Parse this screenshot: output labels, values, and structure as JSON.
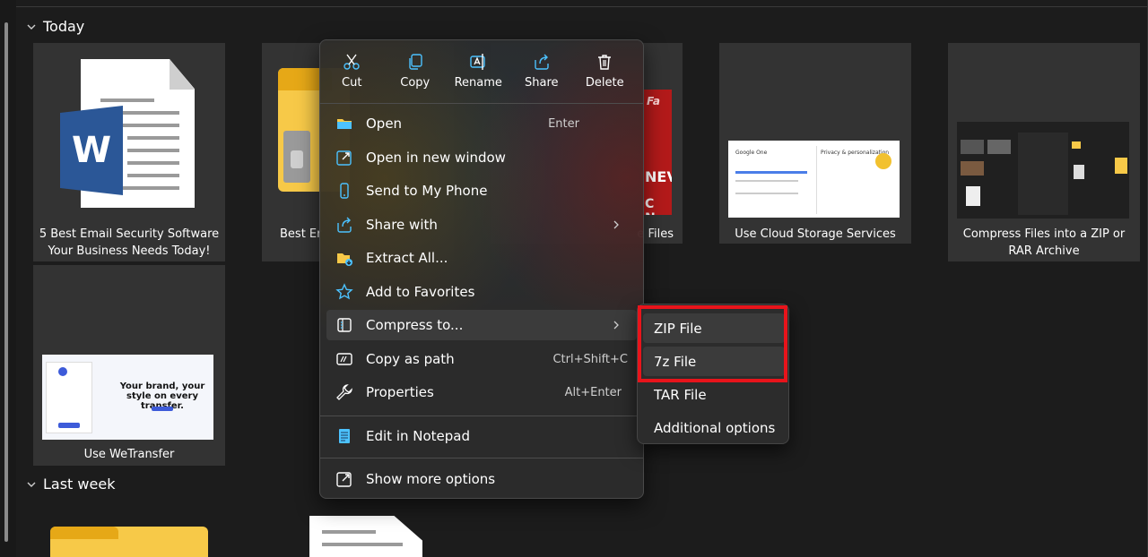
{
  "groups": {
    "today": "Today",
    "last_week": "Last week"
  },
  "tiles": [
    {
      "caption": "5 Best Email Security Software Your Business Needs Today!",
      "icon": "word-doc-icon"
    },
    {
      "caption": "Best Er",
      "icon": "zip-folder-icon"
    },
    {
      "caption": "e Files",
      "icon": "news-image"
    },
    {
      "caption": "Use Cloud Storage Services",
      "icon": "google-one-screenshot"
    },
    {
      "caption": "Compress Files into a ZIP or RAR Archive",
      "icon": "explorer-screenshot"
    },
    {
      "caption": "Use WeTransfer",
      "icon": "wetransfer-screenshot"
    }
  ],
  "thumb_text": {
    "google_one": "Google One",
    "privacy": "Privacy & personalization",
    "wetransfer_headline": "Your brand, your style on every transfer.",
    "word_badge": "W"
  },
  "quick_actions": [
    {
      "label": "Cut",
      "icon": "scissors-icon"
    },
    {
      "label": "Copy",
      "icon": "copy-icon"
    },
    {
      "label": "Rename",
      "icon": "rename-icon"
    },
    {
      "label": "Share",
      "icon": "share-icon"
    },
    {
      "label": "Delete",
      "icon": "trash-icon"
    }
  ],
  "menu": {
    "open": {
      "label": "Open",
      "shortcut": "Enter"
    },
    "open_new_window": {
      "label": "Open in new window"
    },
    "send_phone": {
      "label": "Send to My Phone"
    },
    "share_with": {
      "label": "Share with"
    },
    "extract_all": {
      "label": "Extract All..."
    },
    "favorites": {
      "label": "Add to Favorites"
    },
    "compress": {
      "label": "Compress to..."
    },
    "copy_path": {
      "label": "Copy as path",
      "shortcut": "Ctrl+Shift+C"
    },
    "properties": {
      "label": "Properties",
      "shortcut": "Alt+Enter"
    },
    "notepad": {
      "label": "Edit in Notepad"
    },
    "more_options": {
      "label": "Show more options"
    }
  },
  "submenu": [
    {
      "label": "ZIP File"
    },
    {
      "label": "7z File"
    },
    {
      "label": "TAR File"
    },
    {
      "label": "Additional options"
    }
  ],
  "colors": {
    "background": "#1c1c1c",
    "tile": "#333333",
    "menu": "#2c2c2c",
    "highlight": "#e8141b",
    "accent_blue": "#4cc2ff",
    "folder_yellow": "#f7c948"
  }
}
